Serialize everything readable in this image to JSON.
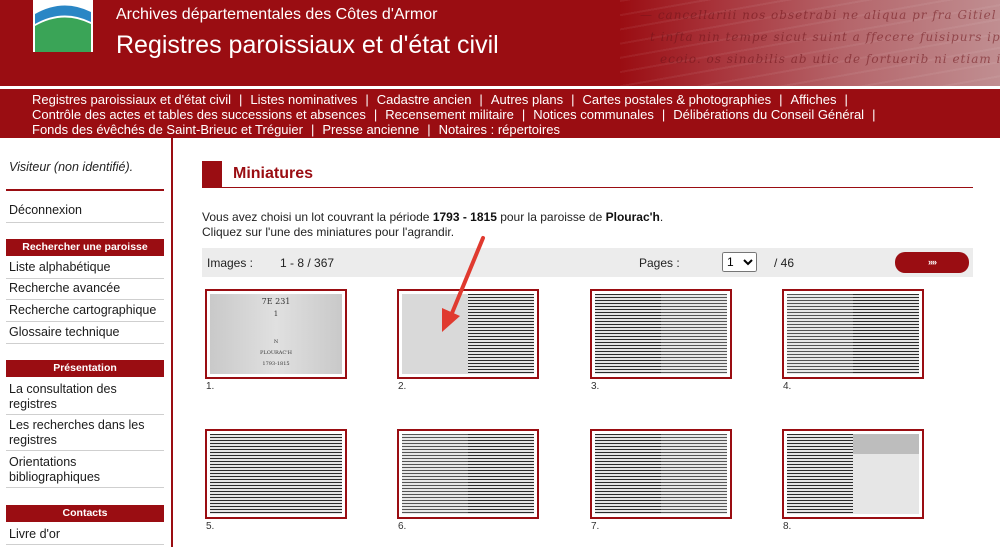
{
  "header": {
    "org": "Archives départementales des Côtes d'Armor",
    "title": "Registres paroissiaux et d'état civil"
  },
  "nav": {
    "line1": [
      "Registres paroissiaux et d'état civil",
      "Listes nominatives",
      "Cadastre ancien",
      "Autres plans",
      "Cartes postales & photographies",
      "Affiches"
    ],
    "line2": [
      "Contrôle des actes et tables des successions et absences",
      "Recensement militaire",
      "Notices communales",
      "Délibérations du Conseil Général"
    ],
    "line3": [
      "Fonds des évêchés de Saint-Brieuc et Tréguier",
      "Presse ancienne",
      "Notaires : répertoires"
    ]
  },
  "sidebar": {
    "visitor": "Visiteur (non identifié).",
    "logout": "Déconnexion",
    "search_head": "Rechercher une paroisse",
    "search_items": [
      "Liste alphabétique",
      "Recherche avancée",
      "Recherche cartographique",
      "Glossaire technique"
    ],
    "presentation_head": "Présentation",
    "presentation_items": [
      "La consultation des registres",
      "Les recherches dans les registres",
      "Orientations bibliographiques"
    ],
    "contacts_head": "Contacts",
    "contacts_items": [
      "Livre d'or"
    ]
  },
  "main": {
    "title": "Miniatures",
    "intro_pre": "Vous avez choisi un lot couvrant la période ",
    "period": "1793 - 1815",
    "intro_mid": " pour la paroisse de ",
    "parish": "Plourac'h",
    "intro_end": ".",
    "intro_line2": "Cliquez sur l'une des miniatures pour l'agrandir.",
    "images_label": "Images :",
    "images_range": "1 - 8 / 367",
    "pages_label": "Pages :",
    "page_selected": "1",
    "pages_total": "/ 46",
    "next_label": "»»",
    "cover_text": [
      "7E 231",
      "1",
      "N",
      "PLOURAC'H",
      "1793-1815"
    ],
    "thumbs": [
      "1.",
      "2.",
      "3.",
      "4.",
      "5.",
      "6.",
      "7.",
      "8."
    ]
  },
  "colors": {
    "brand": "#9a0d12"
  }
}
